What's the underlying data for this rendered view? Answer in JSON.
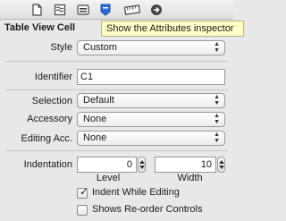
{
  "toolbar": {
    "icons": [
      "file-inspector-icon",
      "quick-help-icon",
      "identity-inspector-icon",
      "attributes-inspector-icon",
      "size-inspector-icon",
      "connections-inspector-icon"
    ],
    "selected_color": "#2f68d8"
  },
  "tooltip": {
    "text": "Show the Attributes inspector"
  },
  "section": {
    "title": "Table View Cell"
  },
  "style": {
    "label": "Style",
    "value": "Custom"
  },
  "identifier": {
    "label": "Identifier",
    "value": "C1"
  },
  "selection": {
    "label": "Selection",
    "value": "Default"
  },
  "accessory": {
    "label": "Accessory",
    "value": "None"
  },
  "editing_acc": {
    "label": "Editing Acc.",
    "value": "None"
  },
  "indentation": {
    "label": "Indentation",
    "level_value": "0",
    "level_label": "Level",
    "width_value": "10",
    "width_label": "Width"
  },
  "indent_while_editing": {
    "label": "Indent While Editing",
    "checked": true
  },
  "shows_reorder": {
    "label": "Shows Re-order Controls",
    "checked": false
  }
}
